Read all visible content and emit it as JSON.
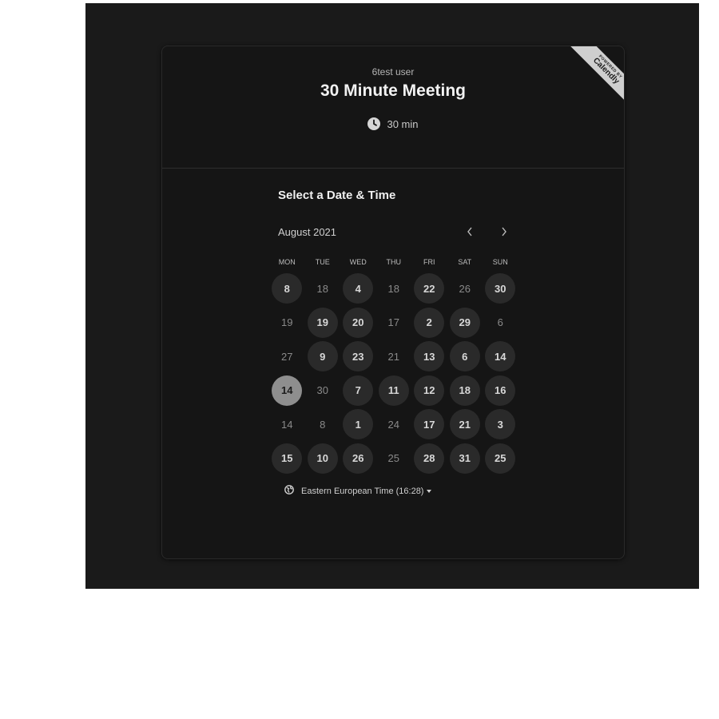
{
  "header": {
    "user_name": "6test user",
    "event_title": "30 Minute Meeting",
    "duration": "30 min"
  },
  "ribbon": {
    "small": "POWERED BY",
    "brand": "Calendly"
  },
  "calendar": {
    "section_title": "Select a Date & Time",
    "month": "August 2021",
    "prev_icon": "chevron-left-icon",
    "next_icon": "chevron-right-icon",
    "weekdays": [
      "MON",
      "TUE",
      "WED",
      "THU",
      "FRI",
      "SAT",
      "SUN"
    ],
    "selected_day": "14",
    "days": [
      {
        "label": "8",
        "available": true
      },
      {
        "label": "18",
        "available": false
      },
      {
        "label": "4",
        "available": true
      },
      {
        "label": "18",
        "available": false
      },
      {
        "label": "22",
        "available": true
      },
      {
        "label": "26",
        "available": false
      },
      {
        "label": "30",
        "available": true
      },
      {
        "label": "19",
        "available": false
      },
      {
        "label": "19",
        "available": true
      },
      {
        "label": "20",
        "available": true
      },
      {
        "label": "17",
        "available": false
      },
      {
        "label": "2",
        "available": true
      },
      {
        "label": "29",
        "available": true
      },
      {
        "label": "6",
        "available": false
      },
      {
        "label": "27",
        "available": false
      },
      {
        "label": "9",
        "available": true
      },
      {
        "label": "23",
        "available": true
      },
      {
        "label": "21",
        "available": false
      },
      {
        "label": "13",
        "available": true
      },
      {
        "label": "6",
        "available": true
      },
      {
        "label": "14",
        "available": true
      },
      {
        "label": "14",
        "available": true,
        "selected": true
      },
      {
        "label": "30",
        "available": false
      },
      {
        "label": "7",
        "available": true
      },
      {
        "label": "11",
        "available": true
      },
      {
        "label": "12",
        "available": true
      },
      {
        "label": "18",
        "available": true
      },
      {
        "label": "16",
        "available": true
      },
      {
        "label": "14",
        "available": false
      },
      {
        "label": "8",
        "available": false
      },
      {
        "label": "1",
        "available": true
      },
      {
        "label": "24",
        "available": false
      },
      {
        "label": "17",
        "available": true
      },
      {
        "label": "21",
        "available": true
      },
      {
        "label": "3",
        "available": true
      },
      {
        "label": "15",
        "available": true
      },
      {
        "label": "10",
        "available": true
      },
      {
        "label": "26",
        "available": true
      },
      {
        "label": "25",
        "available": false
      },
      {
        "label": "28",
        "available": true
      },
      {
        "label": "31",
        "available": true
      },
      {
        "label": "25",
        "available": true
      }
    ]
  },
  "timezone": {
    "label": "Eastern European Time (16:28)",
    "icon": "globe-icon"
  },
  "colors": {
    "background": "#1a1a1a",
    "card": "#151515",
    "available_day": "#2a2a2a",
    "selected_day": "#8e8e8e"
  }
}
